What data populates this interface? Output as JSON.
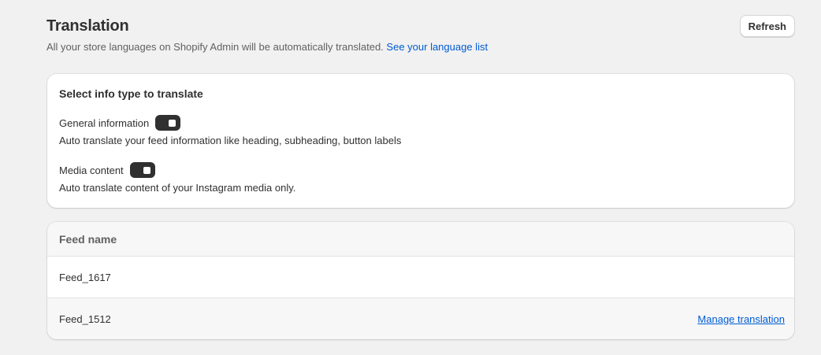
{
  "page": {
    "title": "Translation",
    "subtitle_text": "All your store languages on Shopify Admin will be automatically translated.",
    "subtitle_link": "See your language list",
    "refresh_label": "Refresh"
  },
  "settings": {
    "heading": "Select info type to translate",
    "options": [
      {
        "label": "General information",
        "enabled": true,
        "help": "Auto translate your feed information like heading, subheading, button labels"
      },
      {
        "label": "Media content",
        "enabled": true,
        "help": "Auto translate content of your Instagram media only."
      }
    ]
  },
  "feeds": {
    "column_header": "Feed name",
    "rows": [
      {
        "name": "Feed_1617",
        "action": ""
      },
      {
        "name": "Feed_1512",
        "action": "Manage translation"
      }
    ]
  },
  "colors": {
    "background": "#f1f1f1",
    "link": "#005bd3",
    "toggle_on": "#303030",
    "text": "#303030"
  }
}
